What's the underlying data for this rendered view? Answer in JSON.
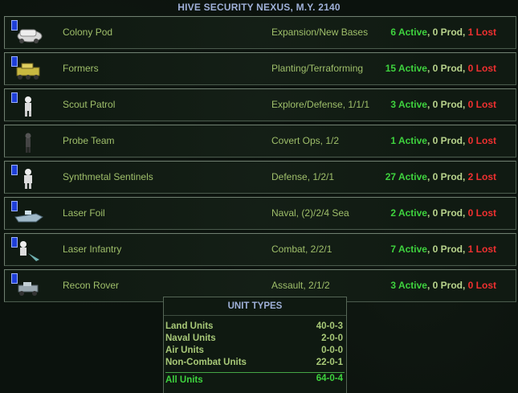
{
  "header": {
    "title": "HIVE SECURITY NEXUS,  M.Y. 2140"
  },
  "units": [
    {
      "icon": "colony-pod-icon",
      "name": "Colony Pod",
      "role": "Expansion/New Bases",
      "active": "6 Active",
      "prod": ", 0 Prod, ",
      "lost": "1 Lost"
    },
    {
      "icon": "formers-icon",
      "name": "Formers",
      "role": "Planting/Terraforming",
      "active": "15 Active",
      "prod": ", 0 Prod, ",
      "lost": "0 Lost"
    },
    {
      "icon": "scout-patrol-icon",
      "name": "Scout Patrol",
      "role": "Explore/Defense, 1/1/1",
      "active": "3 Active",
      "prod": ", 0 Prod, ",
      "lost": "0 Lost"
    },
    {
      "icon": "probe-team-icon",
      "name": "Probe Team",
      "role": "Covert Ops, 1/2",
      "active": "1 Active",
      "prod": ", 0 Prod, ",
      "lost": "0 Lost"
    },
    {
      "icon": "synthmetal-sentinels-icon",
      "name": "Synthmetal Sentinels",
      "role": "Defense, 1/2/1",
      "active": "27 Active",
      "prod": ", 0 Prod, ",
      "lost": "2 Lost"
    },
    {
      "icon": "laser-foil-icon",
      "name": "Laser Foil",
      "role": "Naval, (2)/2/4 Sea",
      "active": "2 Active",
      "prod": ", 0 Prod, ",
      "lost": "0 Lost"
    },
    {
      "icon": "laser-infantry-icon",
      "name": "Laser Infantry",
      "role": "Combat, 2/2/1",
      "active": "7 Active",
      "prod": ", 0 Prod, ",
      "lost": "1 Lost"
    },
    {
      "icon": "recon-rover-icon",
      "name": "Recon Rover",
      "role": "Assault, 2/1/2",
      "active": "3 Active",
      "prod": ", 0 Prod, ",
      "lost": "0 Lost"
    }
  ],
  "summary": {
    "title": "UNIT TYPES",
    "rows": [
      {
        "label": "Land Units",
        "value": "40-0-3"
      },
      {
        "label": "Naval Units",
        "value": "2-0-0"
      },
      {
        "label": "Air Units",
        "value": "0-0-0"
      },
      {
        "label": "Non-Combat Units",
        "value": "22-0-1"
      }
    ],
    "total": {
      "label": "All Units",
      "value": "64-0-4"
    }
  },
  "colors": {
    "active": "#3ed23e",
    "lost": "#f03030",
    "text": "#9fbf6a",
    "title": "#9fb0d8",
    "flag": "#1f3fd8"
  }
}
